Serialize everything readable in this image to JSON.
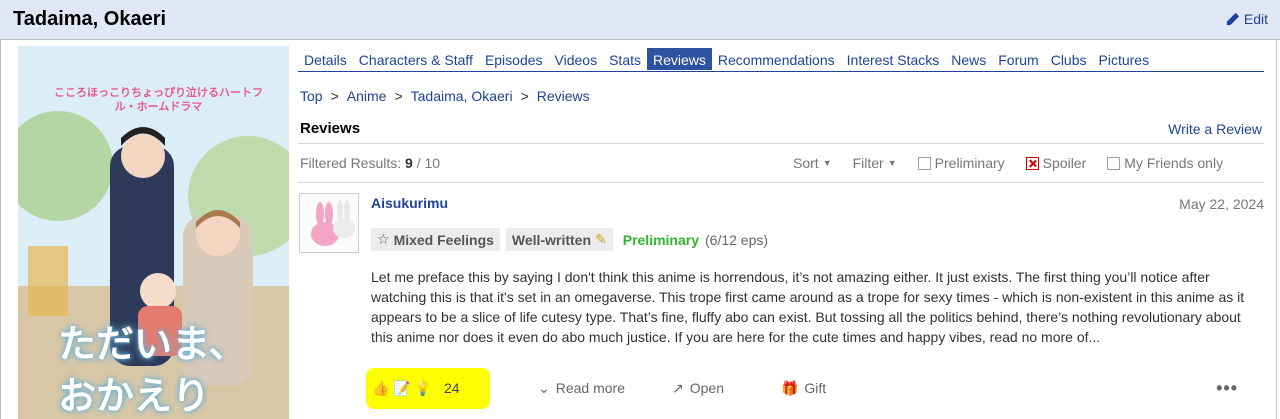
{
  "header": {
    "title": "Tadaima, Okaeri",
    "edit_label": "Edit"
  },
  "tabs": [
    {
      "label": "Details"
    },
    {
      "label": "Characters & Staff"
    },
    {
      "label": "Episodes"
    },
    {
      "label": "Videos"
    },
    {
      "label": "Stats"
    },
    {
      "label": "Reviews"
    },
    {
      "label": "Recommendations"
    },
    {
      "label": "Interest Stacks"
    },
    {
      "label": "News"
    },
    {
      "label": "Forum"
    },
    {
      "label": "Clubs"
    },
    {
      "label": "Pictures"
    }
  ],
  "active_tab": "Reviews",
  "breadcrumb": [
    "Top",
    "Anime",
    "Tadaima, Okaeri",
    "Reviews"
  ],
  "section": {
    "title": "Reviews",
    "write_review": "Write a Review"
  },
  "filters": {
    "filtered_label": "Filtered Results:",
    "filtered_count": "9",
    "filtered_sep": "/",
    "filtered_total": "10",
    "sort_label": "Sort",
    "filter_label": "Filter",
    "preliminary_label": "Preliminary",
    "spoiler_label": "Spoiler",
    "friends_label": "My Friends only"
  },
  "poster": {
    "tagline": "こころほっこりちょっぴり泣けるハートフル・ホームドラマ",
    "logo_line1": "ただいま、",
    "logo_line2": "おかえり"
  },
  "review": {
    "username": "Aisukurimu",
    "date": "May 22, 2024",
    "tag_feeling": "Mixed Feelings",
    "tag_quality": "Well-written",
    "status": "Preliminary",
    "eps": "(6/12 eps)",
    "text": "Let me preface this by saying I don't think this anime is horrendous, it’s not amazing either. It just exists. The first thing you’ll notice after watching this is that it's set in an omegaverse. This trope first came around as a trope for sexy times - which is non-existent in this anime as it appears to be a slice of life cutesy type. That’s fine, fluffy abo can exist. But tossing all the politics behind, there’s nothing revolutionary about this anime nor does it even do abo much justice. If you are here for the cute times and happy vibes, read no more of...",
    "reaction_count": "24",
    "read_more": "Read more",
    "open": "Open",
    "gift": "Gift"
  },
  "colors": {
    "link": "#1d439b",
    "active_tab_bg": "#2e51a2",
    "header_bg": "#e1e7f5",
    "preliminary": "#32b332",
    "highlight": "#fefe00"
  }
}
